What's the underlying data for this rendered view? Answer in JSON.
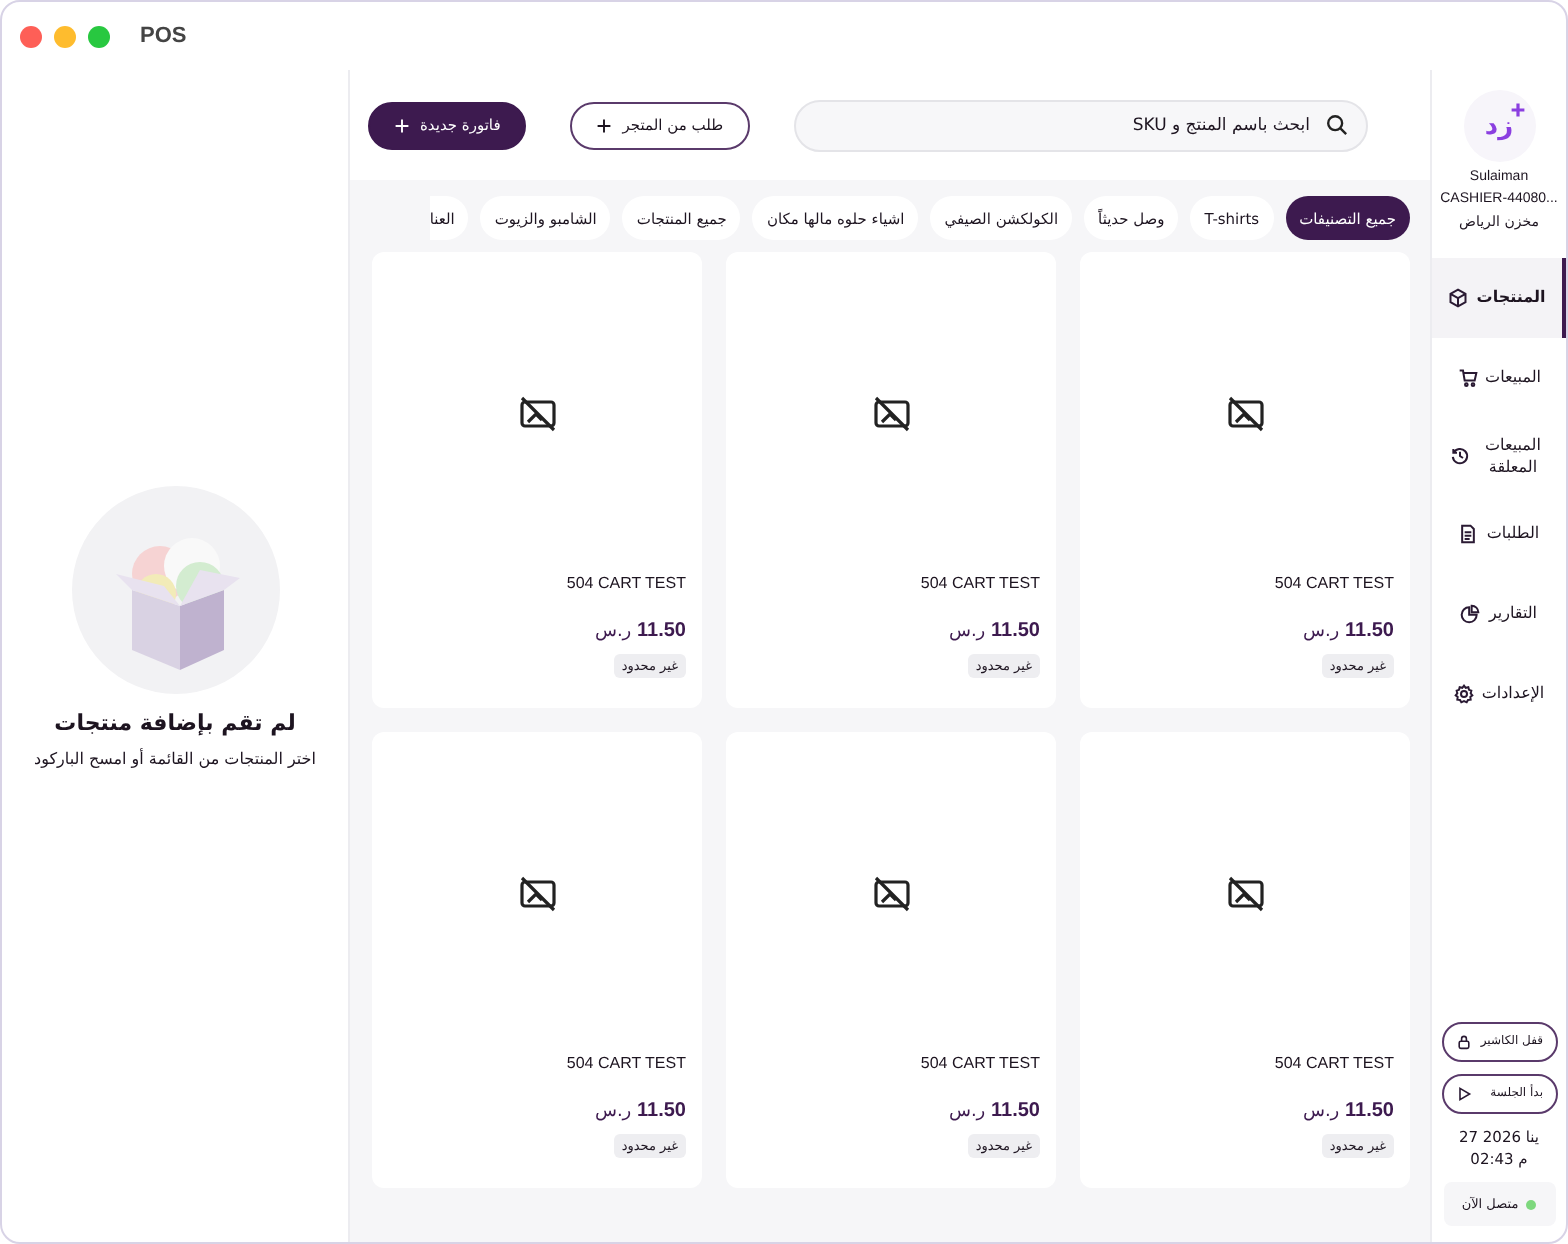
{
  "window": {
    "title": "POS"
  },
  "sidebar": {
    "logo": "زد",
    "user": {
      "name": "Sulaiman",
      "id": "CASHIER-44080...",
      "branch": "مخزن الرياض"
    },
    "items": [
      {
        "label": "المنتجات",
        "selected": true
      },
      {
        "label": "المبيعات",
        "selected": false
      },
      {
        "label": "المبيعات المعلقة",
        "selected": false
      },
      {
        "label": "الطلبات",
        "selected": false
      },
      {
        "label": "التقارير",
        "selected": false
      },
      {
        "label": "الإعدادات",
        "selected": false
      }
    ],
    "actions": [
      {
        "label": "قفل الكاشير"
      },
      {
        "label": "بدأ الجلسة"
      }
    ],
    "date": "27 ينا 2026",
    "time": "02:43 م",
    "status": {
      "label": "متصل الآن",
      "color": "#7ed87e"
    }
  },
  "search": {
    "placeholder": "ابحث باسم المنتج و SKU"
  },
  "buttons": [
    {
      "label": "طلب من المتجر",
      "kind": "outline"
    },
    {
      "label": "فاتورة جديدة",
      "kind": "filled"
    }
  ],
  "categories": [
    {
      "label": "جميع التصنيفات",
      "selected": true
    },
    {
      "label": "T-shirts",
      "selected": false
    },
    {
      "label": "وصل حديثاً",
      "selected": false
    },
    {
      "label": "الكولكشن الصيفي",
      "selected": false
    },
    {
      "label": "اشياء حلوه مالها مكان",
      "selected": false
    },
    {
      "label": "جميع المنتجات",
      "selected": false
    },
    {
      "label": "الشامبو والزيوت",
      "selected": false
    },
    {
      "label": "العنا",
      "selected": false
    }
  ],
  "products": [
    {
      "name": "504 CART TEST",
      "price": "11.50",
      "currency": "ر.س",
      "stock": "غير محدود"
    },
    {
      "name": "504 CART TEST",
      "price": "11.50",
      "currency": "ر.س",
      "stock": "غير محدود"
    },
    {
      "name": "504 CART TEST",
      "price": "11.50",
      "currency": "ر.س",
      "stock": "غير محدود"
    },
    {
      "name": "504 CART TEST",
      "price": "11.50",
      "currency": "ر.س",
      "stock": "غير محدود"
    },
    {
      "name": "504 CART TEST",
      "price": "11.50",
      "currency": "ر.س",
      "stock": "غير محدود"
    },
    {
      "name": "504 CART TEST",
      "price": "11.50",
      "currency": "ر.س",
      "stock": "غير محدود"
    }
  ],
  "cart": {
    "empty_title": "لم تقم بإضافة منتجات",
    "empty_hint": "اختر المنتجات من القائمة أو امسح الباركود"
  }
}
